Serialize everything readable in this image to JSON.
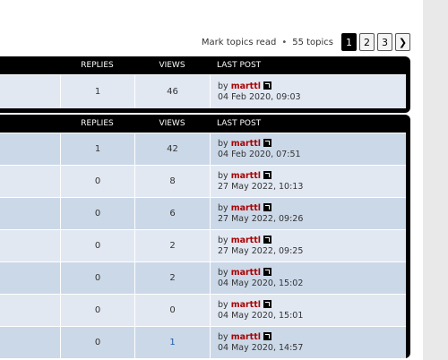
{
  "pagination": {
    "mark_read": "Mark topics read",
    "separator": "•",
    "topic_count": "55 topics",
    "pages": [
      "1",
      "2",
      "3"
    ],
    "next_label": "❯"
  },
  "headers": {
    "replies": "REPLIES",
    "views": "VIEWS",
    "last_post": "LAST POST"
  },
  "announcements": [
    {
      "replies": "1",
      "views": "46",
      "by": "by",
      "author": "marttl",
      "date": "04 Feb 2020, 09:03"
    }
  ],
  "topics": [
    {
      "replies": "1",
      "views": "42",
      "by": "by",
      "author": "marttl",
      "date": "04 Feb 2020, 07:51"
    },
    {
      "replies": "0",
      "views": "8",
      "by": "by",
      "author": "marttl",
      "date": "27 May 2022, 10:13"
    },
    {
      "replies": "0",
      "views": "6",
      "by": "by",
      "author": "marttl",
      "date": "27 May 2022, 09:26"
    },
    {
      "replies": "0",
      "views": "2",
      "by": "by",
      "author": "marttl",
      "date": "27 May 2022, 09:25"
    },
    {
      "replies": "0",
      "views": "2",
      "by": "by",
      "author": "marttl",
      "date": "04 May 2020, 15:02"
    },
    {
      "replies": "0",
      "views": "0",
      "by": "by",
      "author": "marttl",
      "date": "04 May 2020, 15:01"
    },
    {
      "replies": "0",
      "views": "1",
      "by": "by",
      "author": "marttl",
      "date": "04 May 2020, 14:57"
    }
  ]
}
